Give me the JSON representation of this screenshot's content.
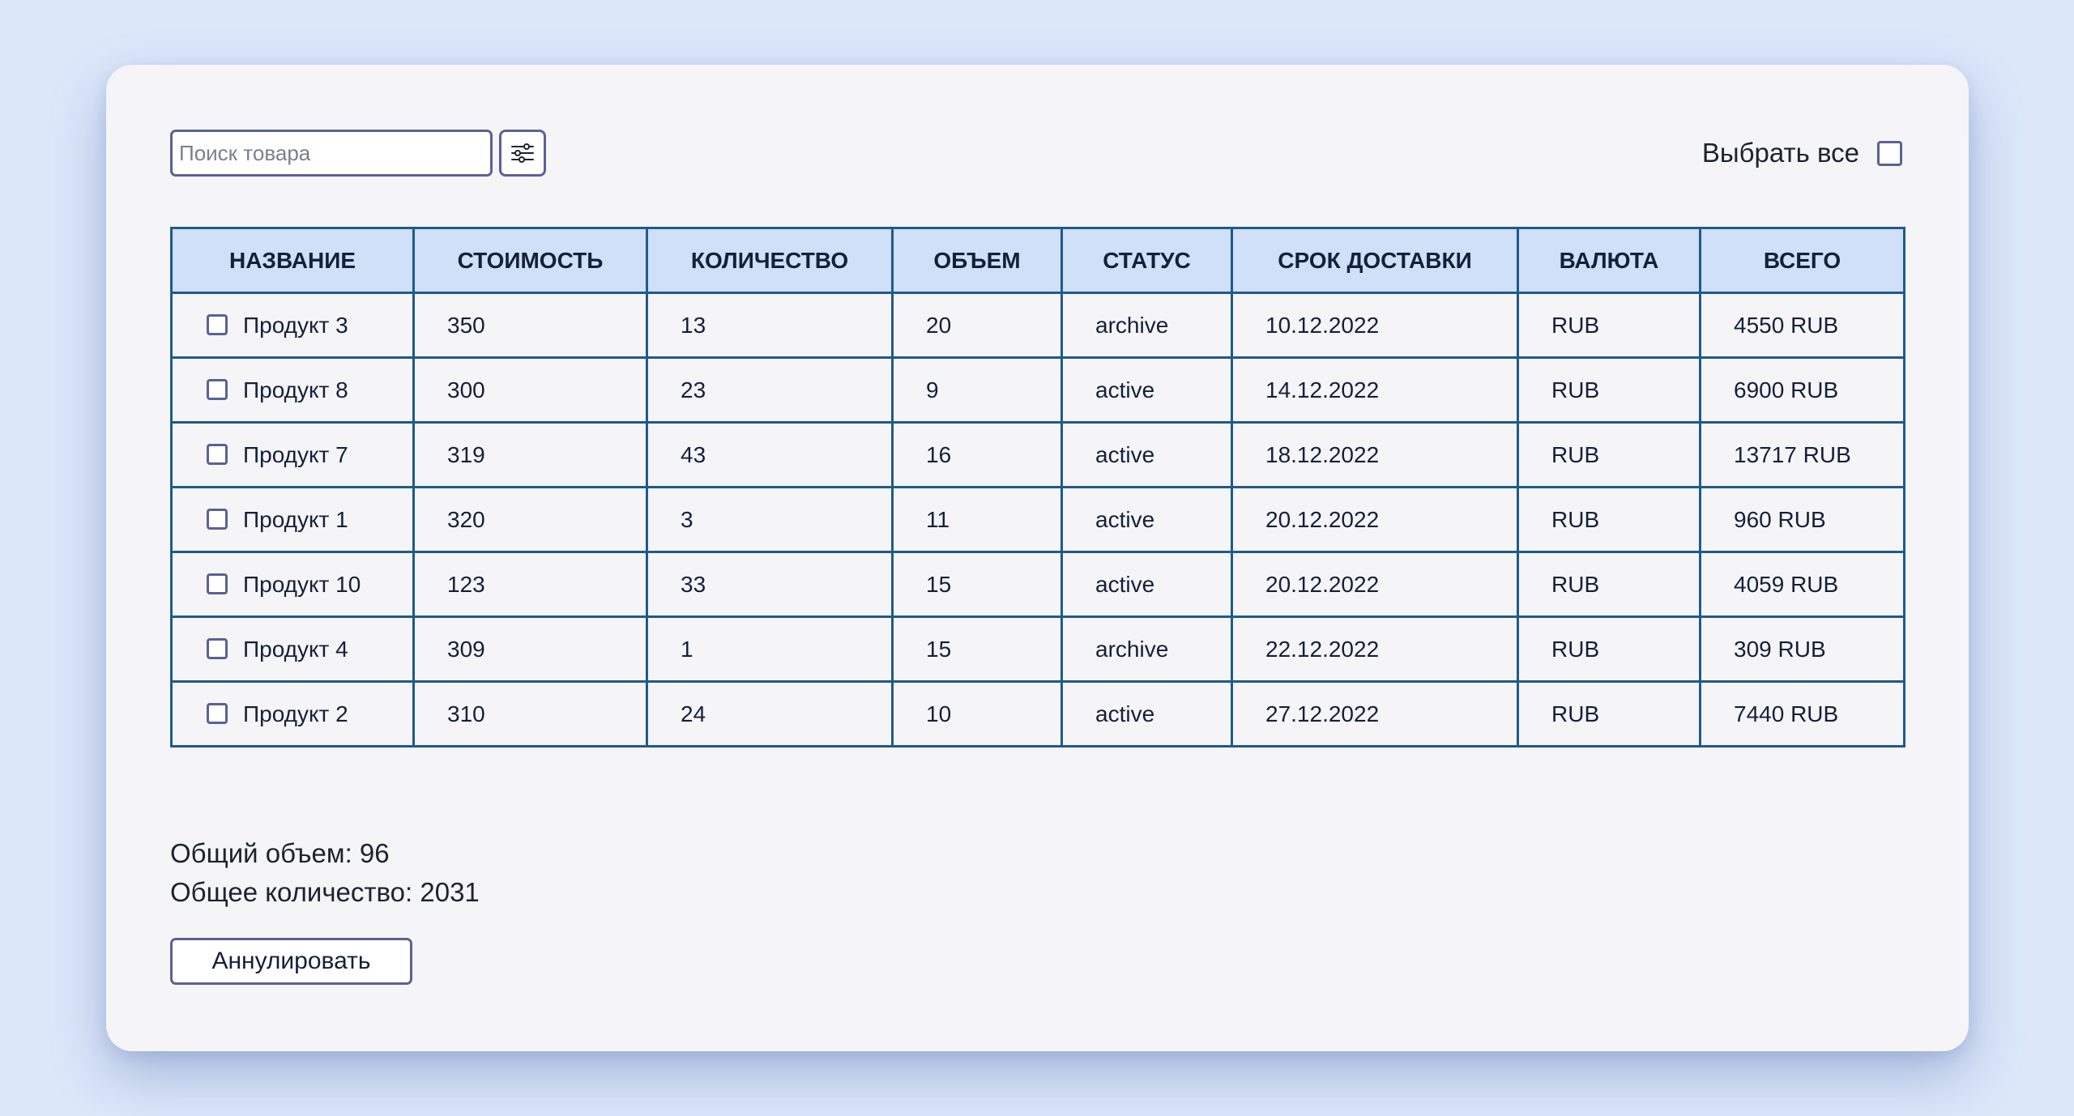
{
  "search": {
    "value": "",
    "placeholder": "Поиск товара"
  },
  "filter_button": {
    "icon": "sliders-icon"
  },
  "select_all": {
    "label": "Выбрать все",
    "checked": false
  },
  "table": {
    "columns": [
      "НАЗВАНИЕ",
      "СТОИМОСТЬ",
      "КОЛИЧЕСТВО",
      "ОБЪЕМ",
      "СТАТУС",
      "СРОК ДОСТАВКИ",
      "ВАЛЮТА",
      "ВСЕГО"
    ],
    "rows": [
      {
        "name": "Продукт 3",
        "price": "350",
        "quantity": "13",
        "volume": "20",
        "status": "archive",
        "delivery": "10.12.2022",
        "currency": "RUB",
        "total": "4550 RUB",
        "checked": false
      },
      {
        "name": "Продукт 8",
        "price": "300",
        "quantity": "23",
        "volume": "9",
        "status": "active",
        "delivery": "14.12.2022",
        "currency": "RUB",
        "total": "6900 RUB",
        "checked": false
      },
      {
        "name": "Продукт 7",
        "price": "319",
        "quantity": "43",
        "volume": "16",
        "status": "active",
        "delivery": "18.12.2022",
        "currency": "RUB",
        "total": "13717 RUB",
        "checked": false
      },
      {
        "name": "Продукт 1",
        "price": "320",
        "quantity": "3",
        "volume": "11",
        "status": "active",
        "delivery": "20.12.2022",
        "currency": "RUB",
        "total": "960 RUB",
        "checked": false
      },
      {
        "name": "Продукт 10",
        "price": "123",
        "quantity": "33",
        "volume": "15",
        "status": "active",
        "delivery": "20.12.2022",
        "currency": "RUB",
        "total": "4059 RUB",
        "checked": false
      },
      {
        "name": "Продукт 4",
        "price": "309",
        "quantity": "1",
        "volume": "15",
        "status": "archive",
        "delivery": "22.12.2022",
        "currency": "RUB",
        "total": "309 RUB",
        "checked": false
      },
      {
        "name": "Продукт 2",
        "price": "310",
        "quantity": "24",
        "volume": "10",
        "status": "active",
        "delivery": "27.12.2022",
        "currency": "RUB",
        "total": "7440 RUB",
        "checked": false
      }
    ]
  },
  "summary": {
    "total_volume": "Общий объем: 96",
    "total_quantity": "Общее количество: 2031"
  },
  "cancel_button": {
    "label": "Аннулировать"
  },
  "colors": {
    "background": "#dce8fa",
    "card": "#f5f5f8",
    "header_fill": "#cfe0f8",
    "table_border": "#1f5a8c",
    "control_border": "#5b6196"
  }
}
